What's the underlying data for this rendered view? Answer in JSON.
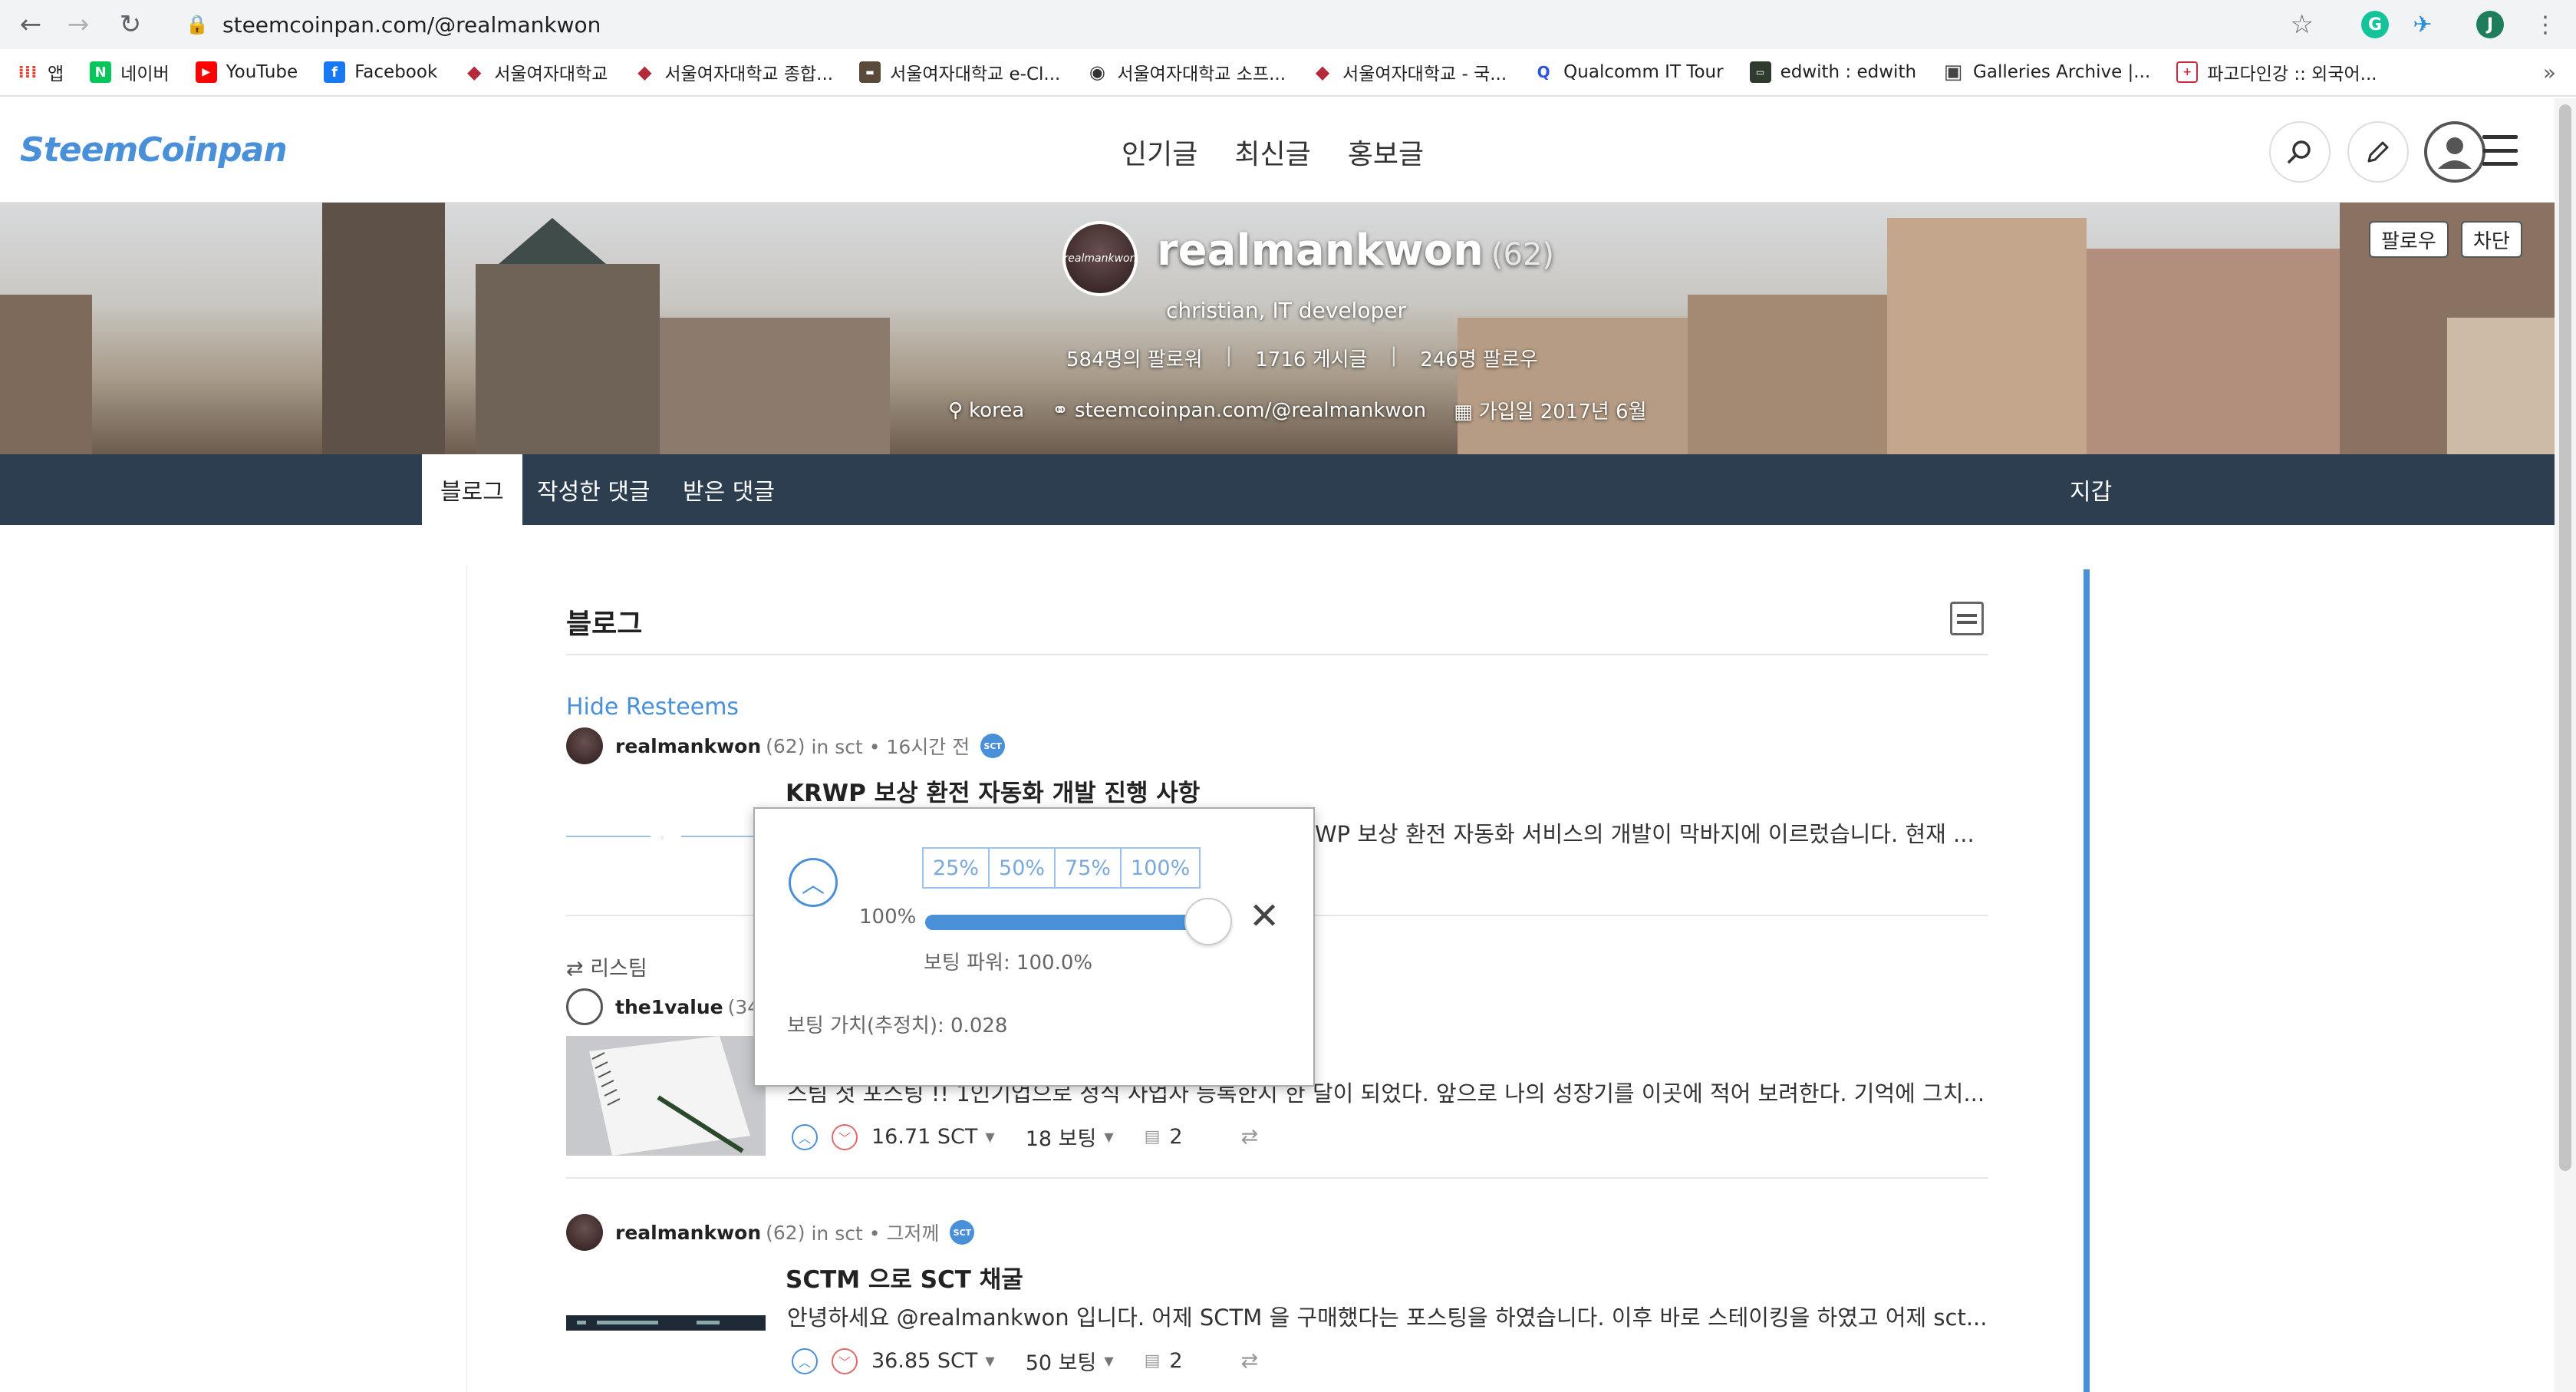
{
  "browser": {
    "url": "steemcoinpan.com/@realmankwon",
    "profile_initial": "J",
    "bookmarks": [
      {
        "label": "앱",
        "icon": "apps-grid-icon",
        "color": "#4285f4"
      },
      {
        "label": "네이버",
        "icon": "naver-icon",
        "color": "#03c75a"
      },
      {
        "label": "YouTube",
        "icon": "youtube-icon",
        "color": "#ff0000"
      },
      {
        "label": "Facebook",
        "icon": "facebook-icon",
        "color": "#1877f2"
      },
      {
        "label": "서울여자대학교",
        "icon": "swu-icon",
        "color": "#b52a3a"
      },
      {
        "label": "서울여자대학교 종합...",
        "icon": "swu-icon",
        "color": "#b52a3a"
      },
      {
        "label": "서울여자대학교 e-Cl...",
        "icon": "ecl-icon",
        "color": "#5a4a3a"
      },
      {
        "label": "서울여자대학교 소프...",
        "icon": "globe-icon",
        "color": "#333333"
      },
      {
        "label": "서울여자대학교 - 국...",
        "icon": "swu-icon",
        "color": "#b52a3a"
      },
      {
        "label": "Qualcomm IT Tour",
        "icon": "qualcomm-icon",
        "color": "#3253dc"
      },
      {
        "label": "edwith : edwith",
        "icon": "edwith-icon",
        "color": "#2f3b2f"
      },
      {
        "label": "Galleries Archive |...",
        "icon": "gallery-icon",
        "color": "#444444"
      },
      {
        "label": "파고다인강 :: 외국어...",
        "icon": "pagoda-icon",
        "color": "#d0273e"
      }
    ]
  },
  "header": {
    "logo": "SteemCoinpan",
    "nav": [
      "인기글",
      "최신글",
      "홍보글"
    ]
  },
  "profile": {
    "avatar_text": "realmankwon",
    "name": "realmankwon",
    "reputation": "(62)",
    "about": "christian, IT developer",
    "stats": [
      "584명의 팔로워",
      "1716 게시글",
      "246명 팔로우"
    ],
    "location": "korea",
    "website": "steemcoinpan.com/@realmankwon",
    "joined": "가입일 2017년 6월",
    "follow_label": "팔로우",
    "block_label": "차단"
  },
  "tabs": {
    "blog": "블로그",
    "comments": "작성한 댓글",
    "replies": "받은 댓글",
    "wallet": "지갑"
  },
  "blog": {
    "title": "블로그",
    "hide_resteems": "Hide Resteems",
    "resteem_label": "리스팀",
    "posts": [
      {
        "author": "realmankwon",
        "rep": "(62)",
        "meta": "in sct • 16시간 전",
        "badge": "SCT",
        "title": "KRWP 보상 환전 자동화 개발 진행 사항",
        "excerpt": "WP 보상 환전 자동화 서비스의 개발이 막바지에 이르렀습니다. 현재 ..."
      },
      {
        "author": "the1value",
        "rep": "(34)",
        "excerpt": "스팀 첫 포스팅 !! 1인기업으로 정식 사업자 등록한지 한 달이 되었다. 앞으로 나의 성장기를 이곳에 적어 보려한다. 기억에 그치...",
        "payout": "16.71 SCT",
        "votes": "18 보팅",
        "comments": "2"
      },
      {
        "author": "realmankwon",
        "rep": "(62)",
        "meta": "in sct • 그저께",
        "badge": "SCT",
        "title": "SCTM 으로 SCT 채굴",
        "excerpt": "안녕하세요 @realmankwon 입니다. 어제 SCTM 을 구매했다는 포스팅을 하였습니다. 이후 바로 스테이킹을 하였고 어제 sct...",
        "payout": "36.85 SCT",
        "votes": "50 보팅",
        "comments": "2"
      }
    ]
  },
  "vote_popup": {
    "presets": [
      "25%",
      "50%",
      "75%",
      "100%"
    ],
    "current_weight_label": "100%",
    "current_weight": 1.0,
    "voting_power": "보팅 파워: 100.0%",
    "vote_value": "보팅 가치(추정치): 0.028"
  },
  "colors": {
    "accent": "#4a90d9",
    "tabbar": "#2c3e50",
    "downvote": "#e06a6a"
  }
}
